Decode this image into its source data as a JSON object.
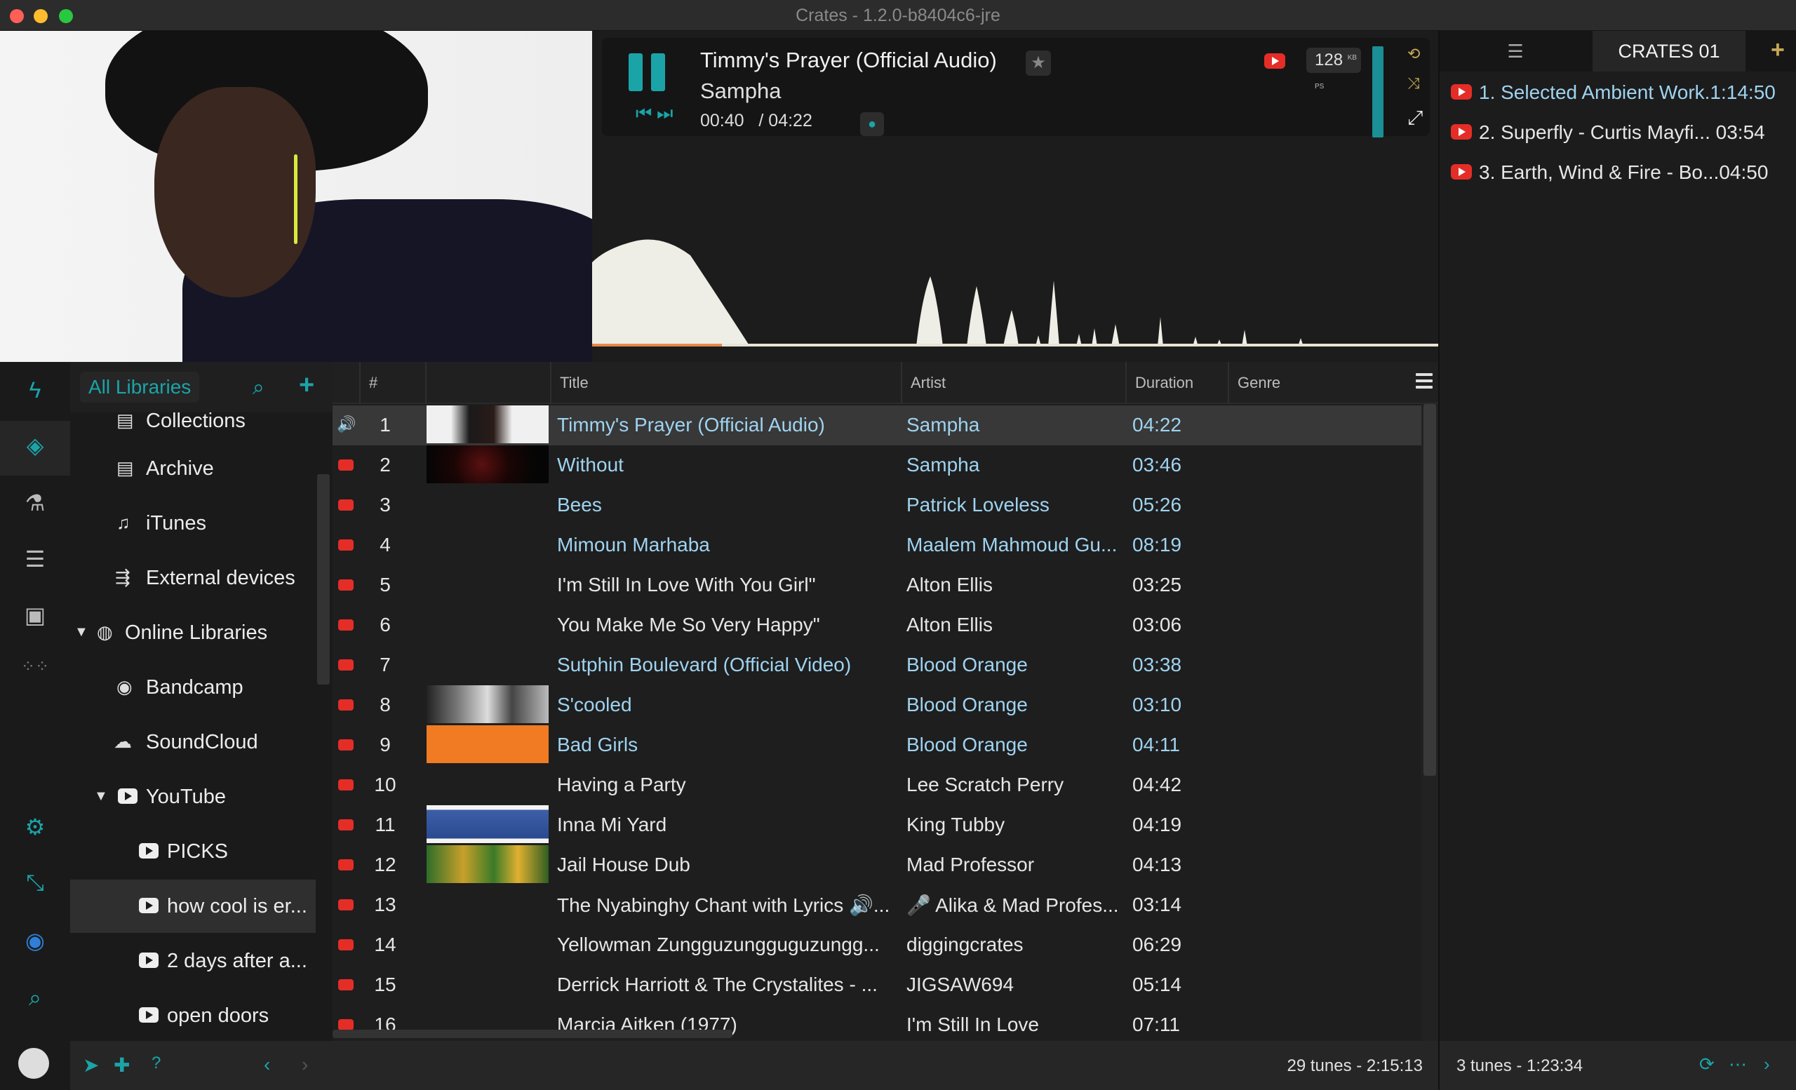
{
  "window": {
    "title": "Crates - 1.2.0-b8404c6-jre"
  },
  "now_playing": {
    "title": "Timmy's Prayer (Official Audio)",
    "artist": "Sampha",
    "elapsed": "00:40",
    "total": "/ 04:22",
    "bitrate": "128",
    "bitrate_unit": "KB PS",
    "progress_fraction": 0.153
  },
  "crates": {
    "tab_label": "CRATES 01",
    "items": [
      {
        "label": "1. Selected Ambient Work.1:14:50"
      },
      {
        "label": "2. Superfly - Curtis Mayfi... 03:54"
      },
      {
        "label": "3. Earth, Wind & Fire - Bo...04:50"
      }
    ],
    "footer": "3 tunes - 1:23:34"
  },
  "libraries": {
    "header_label": "All Libraries",
    "items": [
      {
        "label": "Collections"
      },
      {
        "label": "Archive"
      },
      {
        "label": "iTunes"
      },
      {
        "label": "External devices"
      },
      {
        "label": "Online Libraries"
      },
      {
        "label": "Bandcamp"
      },
      {
        "label": "SoundCloud"
      },
      {
        "label": "YouTube"
      },
      {
        "label": "PICKS"
      },
      {
        "label": "how cool is er..."
      },
      {
        "label": "2 days after a..."
      },
      {
        "label": "open doors"
      }
    ]
  },
  "table": {
    "columns": {
      "num": "#",
      "title": "Title",
      "artist": "Artist",
      "duration": "Duration",
      "genre": "Genre"
    },
    "rows": [
      {
        "num": "1",
        "title": "Timmy's Prayer (Official Audio)",
        "artist": "Sampha",
        "duration": "04:22"
      },
      {
        "num": "2",
        "title": "Without",
        "artist": "Sampha",
        "duration": "03:46"
      },
      {
        "num": "3",
        "title": "Bees",
        "artist": "Patrick Loveless",
        "duration": "05:26"
      },
      {
        "num": "4",
        "title": "Mimoun Marhaba",
        "artist": "Maalem Mahmoud Gu...",
        "duration": "08:19"
      },
      {
        "num": "5",
        "title": "I'm Still In Love With You Girl\"",
        "artist": "Alton Ellis",
        "duration": "03:25"
      },
      {
        "num": "6",
        "title": "You Make Me So Very Happy\"",
        "artist": "Alton Ellis",
        "duration": "03:06"
      },
      {
        "num": "7",
        "title": "Sutphin Boulevard (Official Video)",
        "artist": "Blood Orange",
        "duration": "03:38"
      },
      {
        "num": "8",
        "title": "S'cooled",
        "artist": "Blood Orange",
        "duration": "03:10"
      },
      {
        "num": "9",
        "title": "Bad Girls",
        "artist": "Blood Orange",
        "duration": "04:11"
      },
      {
        "num": "10",
        "title": "Having a Party",
        "artist": "Lee Scratch Perry",
        "duration": "04:42"
      },
      {
        "num": "11",
        "title": "Inna Mi Yard",
        "artist": "King Tubby",
        "duration": "04:19"
      },
      {
        "num": "12",
        "title": "Jail House Dub",
        "artist": "Mad Professor",
        "duration": "04:13"
      },
      {
        "num": "13",
        "title": "The Nyabinghy Chant with Lyrics 🔊...",
        "artist": "🎤 Alika & Mad Profes...",
        "duration": "03:14"
      },
      {
        "num": "14",
        "title": "Yellowman Zungguzungguguzungg...",
        "artist": "diggingcrates",
        "duration": "06:29"
      },
      {
        "num": "15",
        "title": "Derrick Harriott & The Crystalites - ...",
        "artist": "JIGSAW694",
        "duration": "05:14"
      },
      {
        "num": "16",
        "title": "Marcia Aitken (1977)",
        "artist": "I'm Still In Love",
        "duration": "07:11"
      }
    ],
    "footer": "29 tunes - 2:15:13"
  },
  "colors": {
    "accent": "#1ba4a8",
    "gold": "#c8a856",
    "youtube": "#e52d27",
    "link": "#9fd3f0"
  }
}
